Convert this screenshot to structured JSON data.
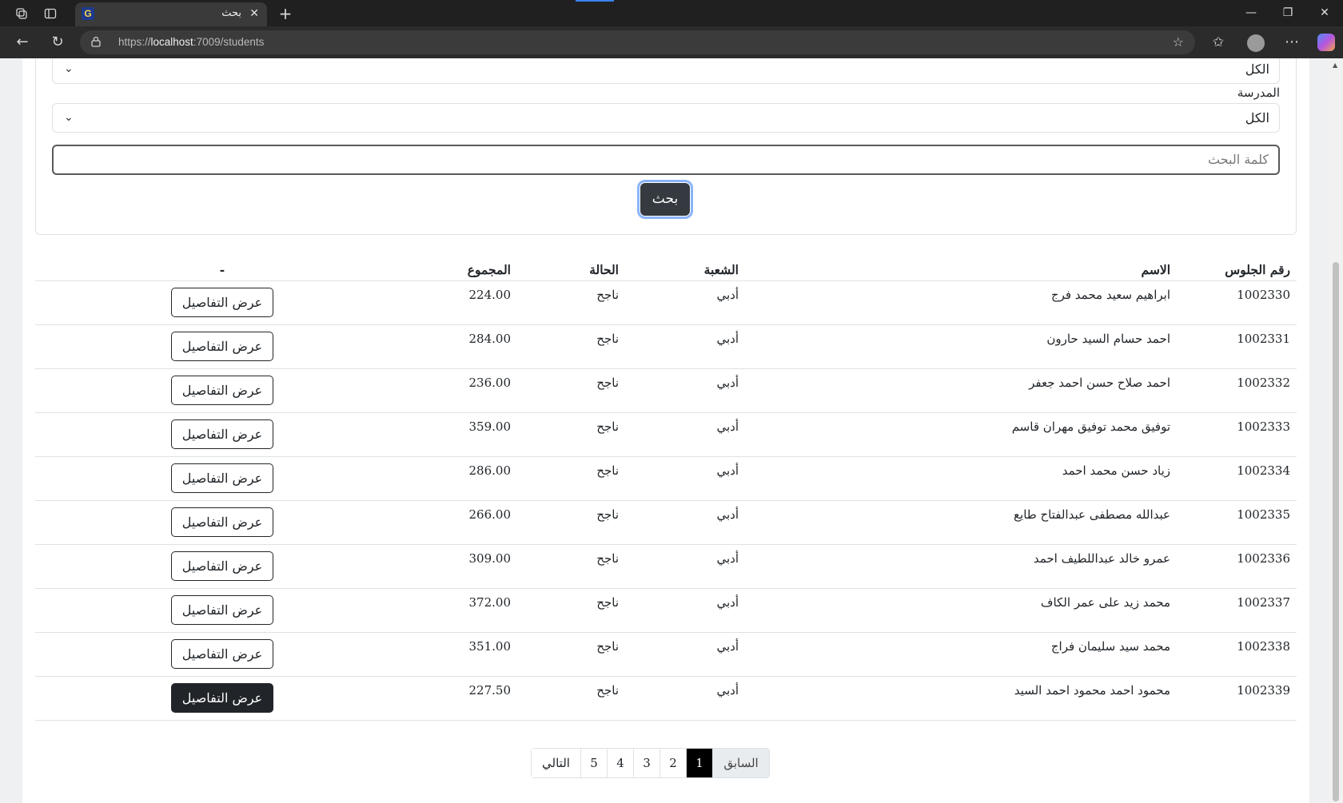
{
  "browser": {
    "tab_title": "بحث",
    "favicon_letter": "G",
    "url_prefix": "https://",
    "url_host": "localhost",
    "url_rest": ":7009/students"
  },
  "filters": {
    "select1_value": "الكل",
    "school_label": "المدرسة",
    "school_value": "الكل",
    "search_placeholder": "كلمة البحث",
    "search_button": "بحث"
  },
  "table": {
    "headers": {
      "seat": "رقم الجلوس",
      "name": "الاسم",
      "division": "الشعبة",
      "status": "الحالة",
      "total": "المجموع",
      "action": "-"
    },
    "details_label": "عرض التفاصيل",
    "rows": [
      {
        "seat": "1002330",
        "name": "ابراهيم سعيد محمد فرج",
        "division": "أدبي",
        "status": "ناجح",
        "total": "224.00"
      },
      {
        "seat": "1002331",
        "name": "احمد حسام السيد حارون",
        "division": "أدبي",
        "status": "ناجح",
        "total": "284.00"
      },
      {
        "seat": "1002332",
        "name": "احمد صلاح حسن احمد جعفر",
        "division": "أدبي",
        "status": "ناجح",
        "total": "236.00"
      },
      {
        "seat": "1002333",
        "name": "توفيق محمد توفيق مهران قاسم",
        "division": "أدبي",
        "status": "ناجح",
        "total": "359.00"
      },
      {
        "seat": "1002334",
        "name": "زياد حسن محمد احمد",
        "division": "أدبي",
        "status": "ناجح",
        "total": "286.00"
      },
      {
        "seat": "1002335",
        "name": "عبدالله مصطفى عبدالفتاح طايع",
        "division": "أدبي",
        "status": "ناجح",
        "total": "266.00"
      },
      {
        "seat": "1002336",
        "name": "عمرو خالد عبداللطيف احمد",
        "division": "أدبي",
        "status": "ناجح",
        "total": "309.00"
      },
      {
        "seat": "1002337",
        "name": "محمد زيد على عمر الكاف",
        "division": "أدبي",
        "status": "ناجح",
        "total": "372.00"
      },
      {
        "seat": "1002338",
        "name": "محمد سيد سليمان فراج",
        "division": "أدبي",
        "status": "ناجح",
        "total": "351.00"
      },
      {
        "seat": "1002339",
        "name": "محمود احمد محمود احمد السيد",
        "division": "أدبي",
        "status": "ناجح",
        "total": "227.50"
      }
    ]
  },
  "pagination": {
    "next": "التالي",
    "pages": [
      "5",
      "4",
      "3",
      "2",
      "1"
    ],
    "current": "1",
    "previous": "السابق"
  }
}
